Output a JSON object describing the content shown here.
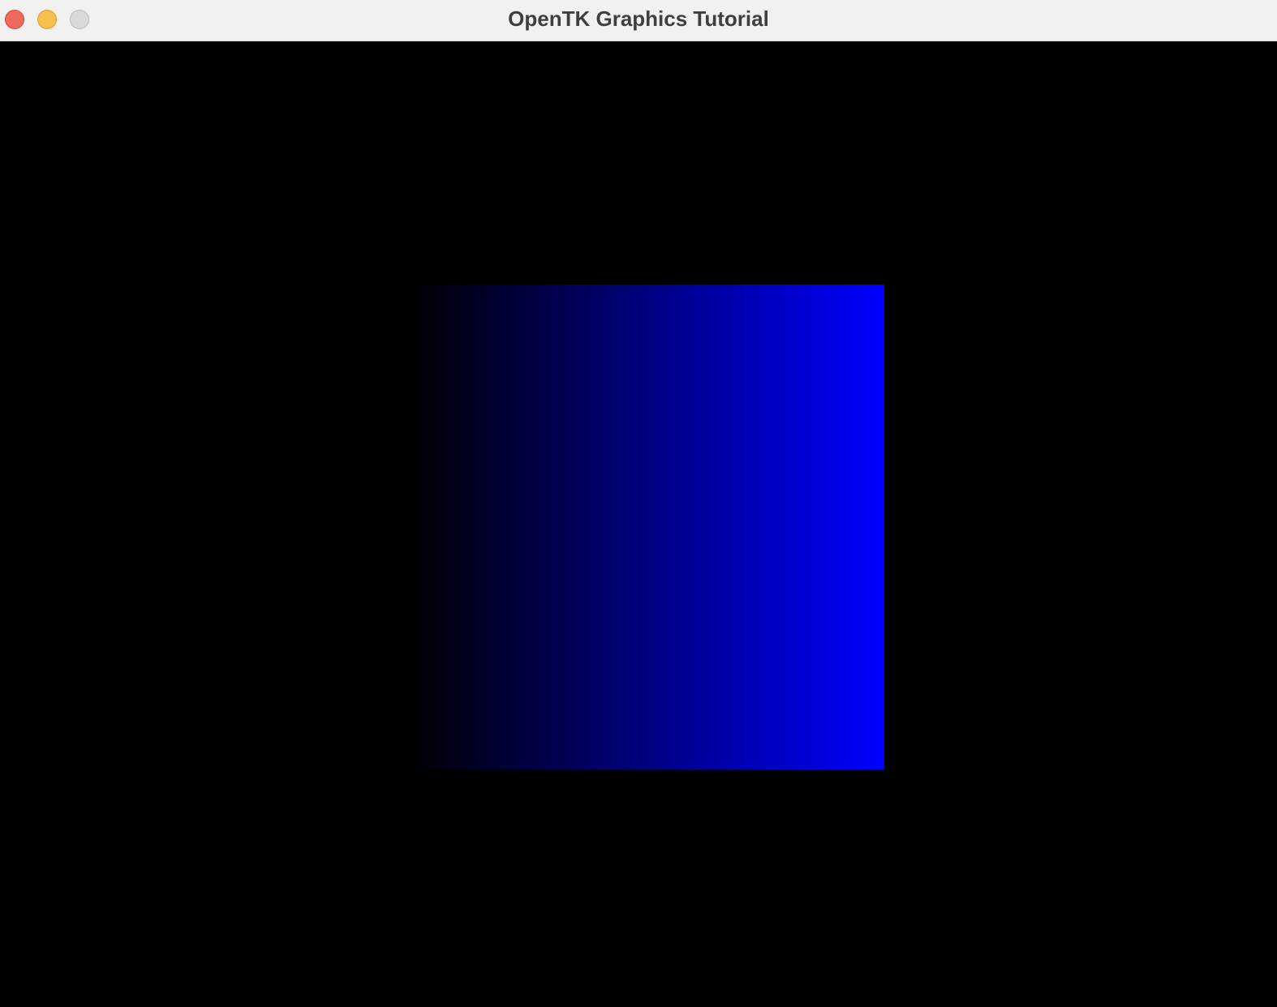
{
  "window": {
    "title": "OpenTK Graphics Tutorial",
    "controls": {
      "close_color": "#ed6a5e",
      "minimize_color": "#f5c04f",
      "zoom_color": "#d9d9d9"
    }
  },
  "viewport": {
    "clear_color": "#000000",
    "quad": {
      "gradient_start_color": "#000000",
      "gradient_end_color": "#0000ff",
      "gradient_direction": "left-to-right"
    }
  }
}
